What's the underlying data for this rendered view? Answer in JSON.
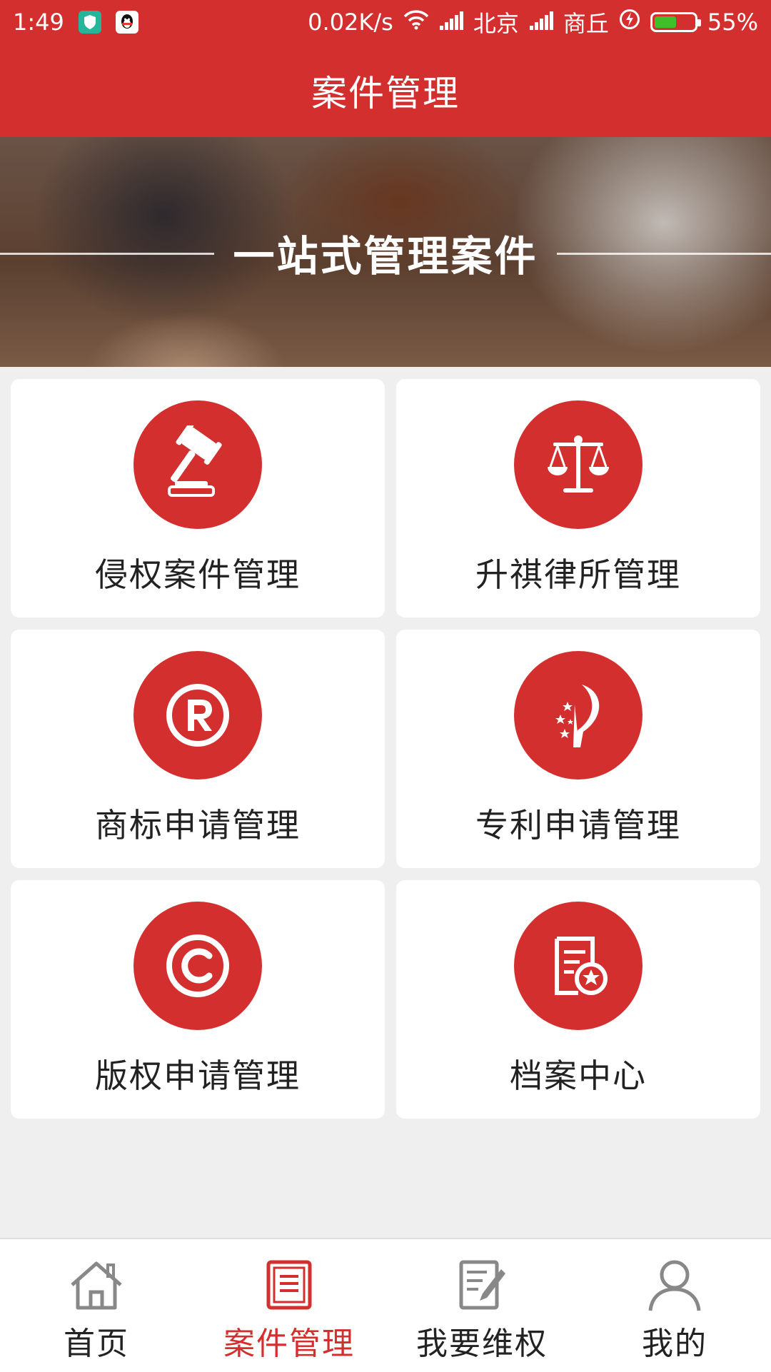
{
  "status_bar": {
    "time": "1:49",
    "net_speed": "0.02K/s",
    "carrier1": "北京",
    "carrier2": "商丘",
    "battery_text": "55%",
    "battery_level": 0.55
  },
  "header": {
    "title": "案件管理"
  },
  "banner": {
    "title": "一站式管理案件"
  },
  "grid": [
    {
      "label": "侵权案件管理",
      "icon": "gavel-icon"
    },
    {
      "label": "升祺律所管理",
      "icon": "scales-icon"
    },
    {
      "label": "商标申请管理",
      "icon": "registered-trademark-icon"
    },
    {
      "label": "专利申请管理",
      "icon": "patent-emblem-icon"
    },
    {
      "label": "版权申请管理",
      "icon": "copyright-icon"
    },
    {
      "label": "档案中心",
      "icon": "archive-document-icon"
    }
  ],
  "nav": {
    "items": [
      {
        "label": "首页",
        "icon": "home-icon"
      },
      {
        "label": "案件管理",
        "icon": "case-list-icon"
      },
      {
        "label": "我要维权",
        "icon": "edit-document-icon"
      },
      {
        "label": "我的",
        "icon": "user-icon"
      }
    ],
    "active_index": 1
  },
  "colors": {
    "accent": "#d32f2f",
    "background": "#efefef",
    "card": "#ffffff"
  }
}
